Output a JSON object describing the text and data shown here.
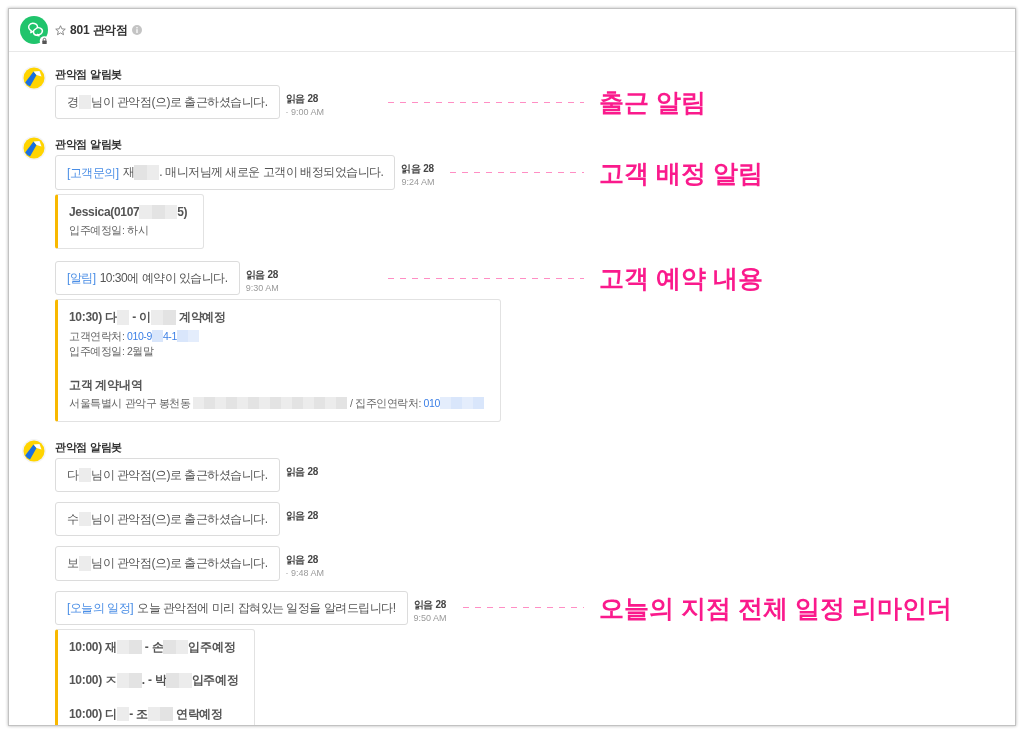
{
  "channel": {
    "title": "801 관악점",
    "starred": false
  },
  "groups": [
    {
      "sender": "관악점 알림봇",
      "items": [
        {
          "kind": "message",
          "parts": [
            {
              "kind": "text",
              "text": "경"
            },
            {
              "kind": "mask"
            },
            {
              "kind": "text",
              "text": "님이 관악점(으)로 출근하셨습니다."
            }
          ],
          "read": "읽음 28",
          "time": "· 9:00 AM",
          "annotation": "출근 알림"
        }
      ]
    },
    {
      "sender": "관악점 알림봇",
      "items": [
        {
          "kind": "message",
          "parts": [
            {
              "kind": "tag",
              "text": "[고객문의]"
            },
            {
              "kind": "text",
              "text": "재"
            },
            {
              "kind": "mask"
            },
            {
              "kind": "mask"
            },
            {
              "kind": "text",
              "text": ". 매니저님께 새로운 고객이 배정되었습니다."
            }
          ],
          "read": "읽음 28",
          "time": "9:24 AM",
          "annotation": "고객 배정 알림"
        },
        {
          "kind": "card",
          "sections": [
            {
              "heading": [
                {
                  "kind": "text",
                  "text": "Jessica(0107"
                },
                {
                  "kind": "mask"
                },
                {
                  "kind": "mask"
                },
                {
                  "kind": "mask"
                },
                {
                  "kind": "text",
                  "text": "5)"
                }
              ],
              "lines": [
                [
                  {
                    "kind": "text",
                    "text": "입주예정일: 하시"
                  }
                ]
              ]
            }
          ]
        },
        {
          "kind": "message",
          "parts": [
            {
              "kind": "tag",
              "text": "[알림]"
            },
            {
              "kind": "text",
              "text": "10:30에 예약이 있습니다."
            }
          ],
          "read": "읽음 28",
          "time": "9:30 AM",
          "annotation": "고객 예약 내용"
        },
        {
          "kind": "card",
          "sections": [
            {
              "heading": [
                {
                  "kind": "text",
                  "text": "10:30) 다"
                },
                {
                  "kind": "mask"
                },
                {
                  "kind": "text",
                  "text": " - 이"
                },
                {
                  "kind": "mask"
                },
                {
                  "kind": "mask"
                },
                {
                  "kind": "text",
                  "text": " 계약예정"
                }
              ],
              "lines": [
                [
                  {
                    "kind": "text",
                    "text": "고객연락처: "
                  },
                  {
                    "kind": "link",
                    "text": "010-9"
                  },
                  {
                    "kind": "linkmask"
                  },
                  {
                    "kind": "link",
                    "text": "4-1"
                  },
                  {
                    "kind": "linkmask"
                  },
                  {
                    "kind": "linkmask"
                  }
                ],
                [
                  {
                    "kind": "text",
                    "text": "입주예정일: 2월말"
                  }
                ]
              ]
            },
            {
              "heading": [
                {
                  "kind": "text",
                  "text": "고객 계약내역"
                }
              ],
              "lines": [
                [
                  {
                    "kind": "text",
                    "text": "서울특별시 관악구 봉천동 "
                  },
                  {
                    "kind": "mask"
                  },
                  {
                    "kind": "mask"
                  },
                  {
                    "kind": "mask"
                  },
                  {
                    "kind": "mask"
                  },
                  {
                    "kind": "mask"
                  },
                  {
                    "kind": "mask"
                  },
                  {
                    "kind": "mask"
                  },
                  {
                    "kind": "mask"
                  },
                  {
                    "kind": "mask"
                  },
                  {
                    "kind": "mask"
                  },
                  {
                    "kind": "mask"
                  },
                  {
                    "kind": "mask"
                  },
                  {
                    "kind": "mask"
                  },
                  {
                    "kind": "mask"
                  },
                  {
                    "kind": "text",
                    "text": " / 집주인연락처: "
                  },
                  {
                    "kind": "link",
                    "text": "010"
                  },
                  {
                    "kind": "linkmask"
                  },
                  {
                    "kind": "linkmask"
                  },
                  {
                    "kind": "linkmask"
                  },
                  {
                    "kind": "linkmask"
                  }
                ]
              ]
            }
          ]
        }
      ]
    },
    {
      "sender": "관악점 알림봇",
      "items": [
        {
          "kind": "message",
          "parts": [
            {
              "kind": "text",
              "text": "다"
            },
            {
              "kind": "mask"
            },
            {
              "kind": "text",
              "text": "님이 관악점(으)로 출근하셨습니다."
            }
          ],
          "read": "읽음 28"
        },
        {
          "kind": "message",
          "parts": [
            {
              "kind": "text",
              "text": "수"
            },
            {
              "kind": "mask"
            },
            {
              "kind": "text",
              "text": "님이 관악점(으)로 출근하셨습니다."
            }
          ],
          "read": "읽음 28"
        },
        {
          "kind": "message",
          "parts": [
            {
              "kind": "text",
              "text": "보"
            },
            {
              "kind": "mask"
            },
            {
              "kind": "text",
              "text": "님이 관악점(으)로 출근하셨습니다."
            }
          ],
          "read": "읽음 28",
          "time": "· 9:48 AM"
        },
        {
          "kind": "message",
          "parts": [
            {
              "kind": "tag",
              "text": "[오늘의 일정]"
            },
            {
              "kind": "text",
              "text": "오늘 관악점에 미리 잡혀있는 일정을 알려드립니다!"
            }
          ],
          "read": "읽음 28",
          "time": "9:50 AM",
          "annotation": "오늘의 지점 전체 일정 리마인더"
        },
        {
          "kind": "card",
          "sections": [
            {
              "heading": [
                {
                  "kind": "text",
                  "text": "10:00) 재"
                },
                {
                  "kind": "mask"
                },
                {
                  "kind": "mask"
                },
                {
                  "kind": "text",
                  "text": " - 손"
                },
                {
                  "kind": "mask"
                },
                {
                  "kind": "mask"
                },
                {
                  "kind": "text",
                  "text": "입주예정"
                }
              ]
            },
            {
              "heading": [
                {
                  "kind": "text",
                  "text": "10:00) ㅈ"
                },
                {
                  "kind": "mask"
                },
                {
                  "kind": "mask"
                },
                {
                  "kind": "text",
                  "text": ". - 박"
                },
                {
                  "kind": "mask"
                },
                {
                  "kind": "mask"
                },
                {
                  "kind": "text",
                  "text": "입주예정"
                }
              ]
            },
            {
              "heading": [
                {
                  "kind": "text",
                  "text": "10:00) 디"
                },
                {
                  "kind": "mask"
                },
                {
                  "kind": "text",
                  "text": "- 조"
                },
                {
                  "kind": "mask"
                },
                {
                  "kind": "mask"
                },
                {
                  "kind": "text",
                  "text": " 연락예정"
                }
              ]
            }
          ]
        }
      ]
    }
  ]
}
